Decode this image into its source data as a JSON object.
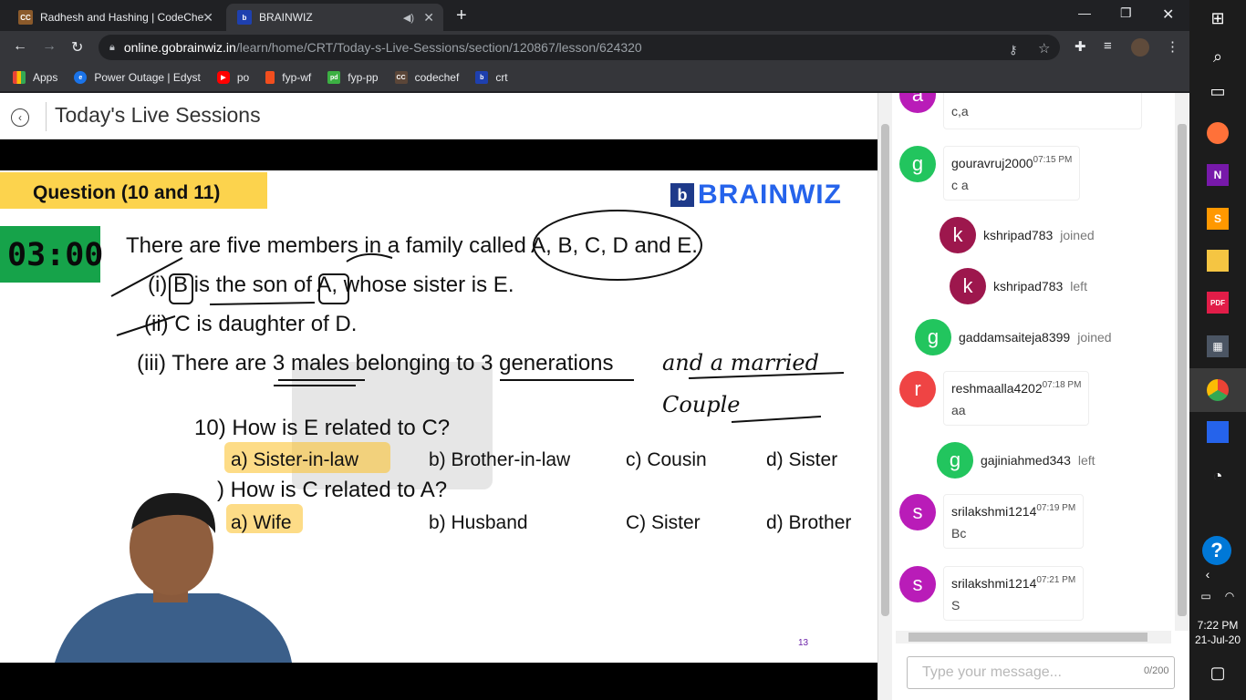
{
  "browser": {
    "tabs": [
      {
        "title": "Radhesh and Hashing | CodeChef",
        "icon": "codechef-icon",
        "active": false
      },
      {
        "title": "BRAINWIZ",
        "icon": "brainwiz-icon",
        "active": true
      }
    ],
    "url_host": "online.gobrainwiz.in",
    "url_path": "/learn/home/CRT/Today-s-Live-Sessions/section/120867/lesson/624320",
    "bookmarks": [
      {
        "label": "Apps",
        "icon": "apps-grid-icon",
        "color": "#4285f4"
      },
      {
        "label": "Power Outage | Edyst",
        "icon": "edyst-icon",
        "color": "#1a73e8"
      },
      {
        "label": "po",
        "icon": "youtube-icon",
        "color": "#ff0000"
      },
      {
        "label": "fyp-wf",
        "icon": "figma-icon",
        "color": "#f24e1e"
      },
      {
        "label": "fyp-pp",
        "icon": "pdf-icon",
        "color": "#3cb043"
      },
      {
        "label": "codechef",
        "icon": "codechef-icon",
        "color": "#5b4638"
      },
      {
        "label": "crt",
        "icon": "brainwiz-icon",
        "color": "#1e40af"
      }
    ]
  },
  "page": {
    "title": "Today's Live Sessions"
  },
  "slide": {
    "heading": "Question (10 and 11)",
    "brand": "BRAINWIZ",
    "timer": "03:00",
    "intro": "There are five members in a family called A, B, C, D and E.",
    "clue1": "(i) B is the son of A, whose sister is E.",
    "clue2": "(ii) C is daughter of D.",
    "clue3": "(iii) There are 3 males belonging to 3 generations",
    "annotation": "and a married Couple",
    "q10": "10) How is E related to C?",
    "q10_opts": [
      "a) Sister-in-law",
      "b) Brother-in-law",
      "c) Cousin",
      "d) Sister"
    ],
    "q11": ") How is C related to A?",
    "q11_opts": [
      "a) Wife",
      "b) Husband",
      "C) Sister",
      "d) Brother"
    ],
    "page_number": "13"
  },
  "chat": {
    "messages": [
      {
        "kind": "msg",
        "initial": "a",
        "user": "",
        "time": "",
        "text": "c,a",
        "color": "#b91cb8"
      },
      {
        "kind": "msg",
        "initial": "g",
        "user": "gouravruj2000",
        "time": "07:15 PM",
        "text": "c a",
        "color": "#22c55e"
      },
      {
        "kind": "event",
        "initial": "k",
        "user": "kshripad783",
        "status": "joined",
        "color": "#9d174d"
      },
      {
        "kind": "event",
        "initial": "k",
        "user": "kshripad783",
        "status": "left",
        "color": "#9d174d"
      },
      {
        "kind": "event",
        "initial": "g",
        "user": "gaddamsaiteja8399",
        "status": "joined",
        "color": "#22c55e"
      },
      {
        "kind": "msg",
        "initial": "r",
        "user": "reshmaalla4202",
        "time": "07:18 PM",
        "text": "aa",
        "color": "#ef4444"
      },
      {
        "kind": "event",
        "initial": "g",
        "user": "gajiniahmed343",
        "status": "left",
        "color": "#22c55e"
      },
      {
        "kind": "msg",
        "initial": "s",
        "user": "srilakshmi1214",
        "time": "07:19 PM",
        "text": "Bc",
        "color": "#b91cb8"
      },
      {
        "kind": "msg",
        "initial": "s",
        "user": "srilakshmi1214",
        "time": "07:21 PM",
        "text": "S",
        "color": "#b91cb8"
      }
    ],
    "input_placeholder": "Type your message...",
    "char_count": "0/200"
  },
  "taskbar": {
    "time": "7:22 PM",
    "date": "21-Jul-20"
  }
}
